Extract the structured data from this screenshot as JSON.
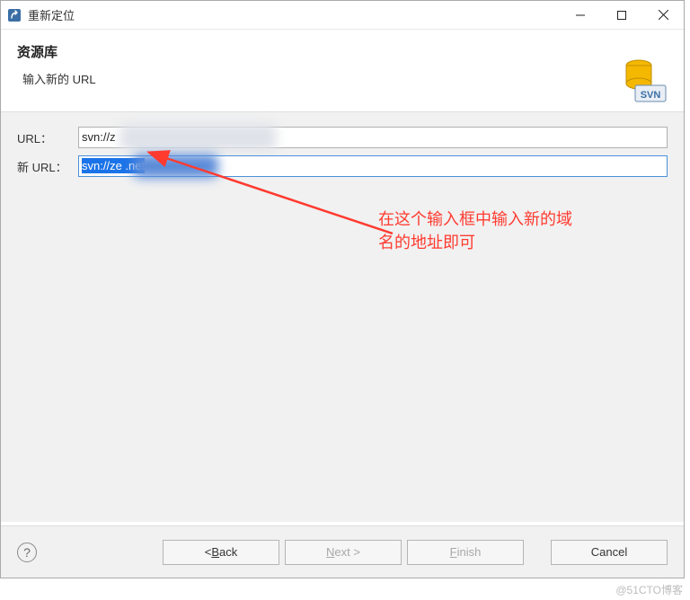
{
  "window": {
    "title": "重新定位"
  },
  "header": {
    "title": "资源库",
    "subtitle": "输入新的 URL"
  },
  "fields": {
    "url_label": "URL：",
    "url_value": "svn://z",
    "new_url_label": "新 URL：",
    "new_url_value": "svn://ze            .net"
  },
  "annotation": {
    "line1": "在这个输入框中输入新的域",
    "line2": "名的地址即可"
  },
  "buttons": {
    "back": "< Back",
    "next": "Next >",
    "finish": "Finish",
    "cancel": "Cancel"
  },
  "watermark": "@51CTO博客"
}
